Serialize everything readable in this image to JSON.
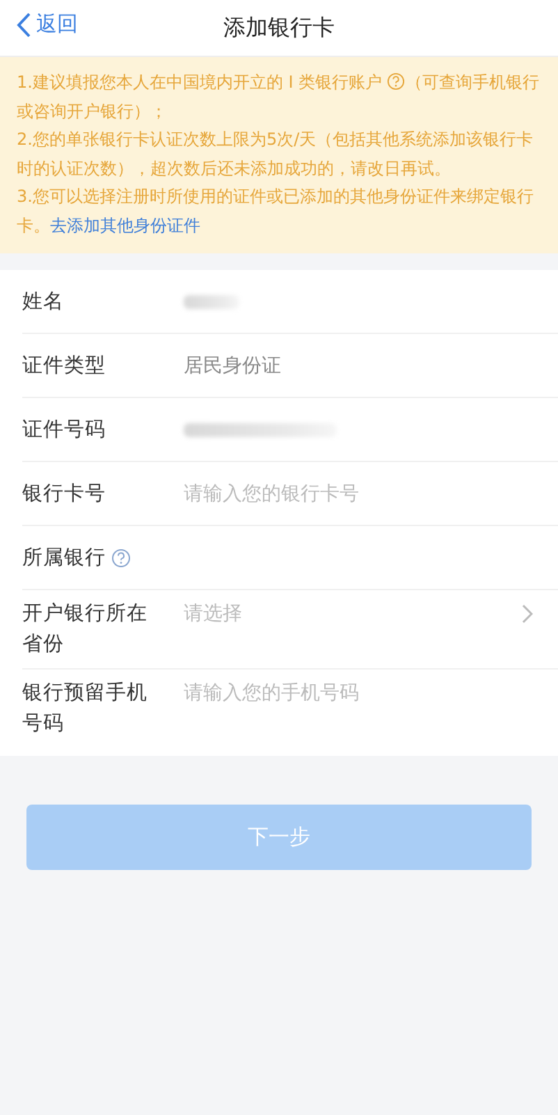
{
  "header": {
    "back": "返回",
    "title": "添加银行卡"
  },
  "notice": [
    {
      "kind": "help",
      "text": "1.建议填报您本人在中国境内开立的 I 类银行账户",
      "after": "（可查询手机银行或咨询开户银行）；"
    },
    {
      "kind": "plain",
      "text": "2.您的单张银行卡认证次数上限为5次/天（包括其他系统添加该银行卡时的认证次数），超次数后还未添加成功的，请改日再试。"
    },
    {
      "kind": "link",
      "text": "3.您可以选择注册时所使用的证件或已添加的其他身份证件来绑定银行卡。",
      "link": "去添加其他身份证件"
    }
  ],
  "fields": [
    {
      "kind": "redacted",
      "label": "姓名"
    },
    {
      "kind": "value",
      "label": "证件类型",
      "value": "居民身份证"
    },
    {
      "kind": "redacted",
      "label": "证件号码"
    },
    {
      "kind": "input",
      "label": "银行卡号",
      "placeholder": "请输入您的银行卡号"
    },
    {
      "kind": "help",
      "label": "所属银行"
    },
    {
      "kind": "select",
      "label": "开户银行所在省份",
      "placeholder": "请选择"
    },
    {
      "kind": "input",
      "label": "银行预留手机号码",
      "placeholder": "请输入您的手机号码"
    }
  ],
  "next_button": {
    "label": "下一步",
    "disabled": true
  }
}
